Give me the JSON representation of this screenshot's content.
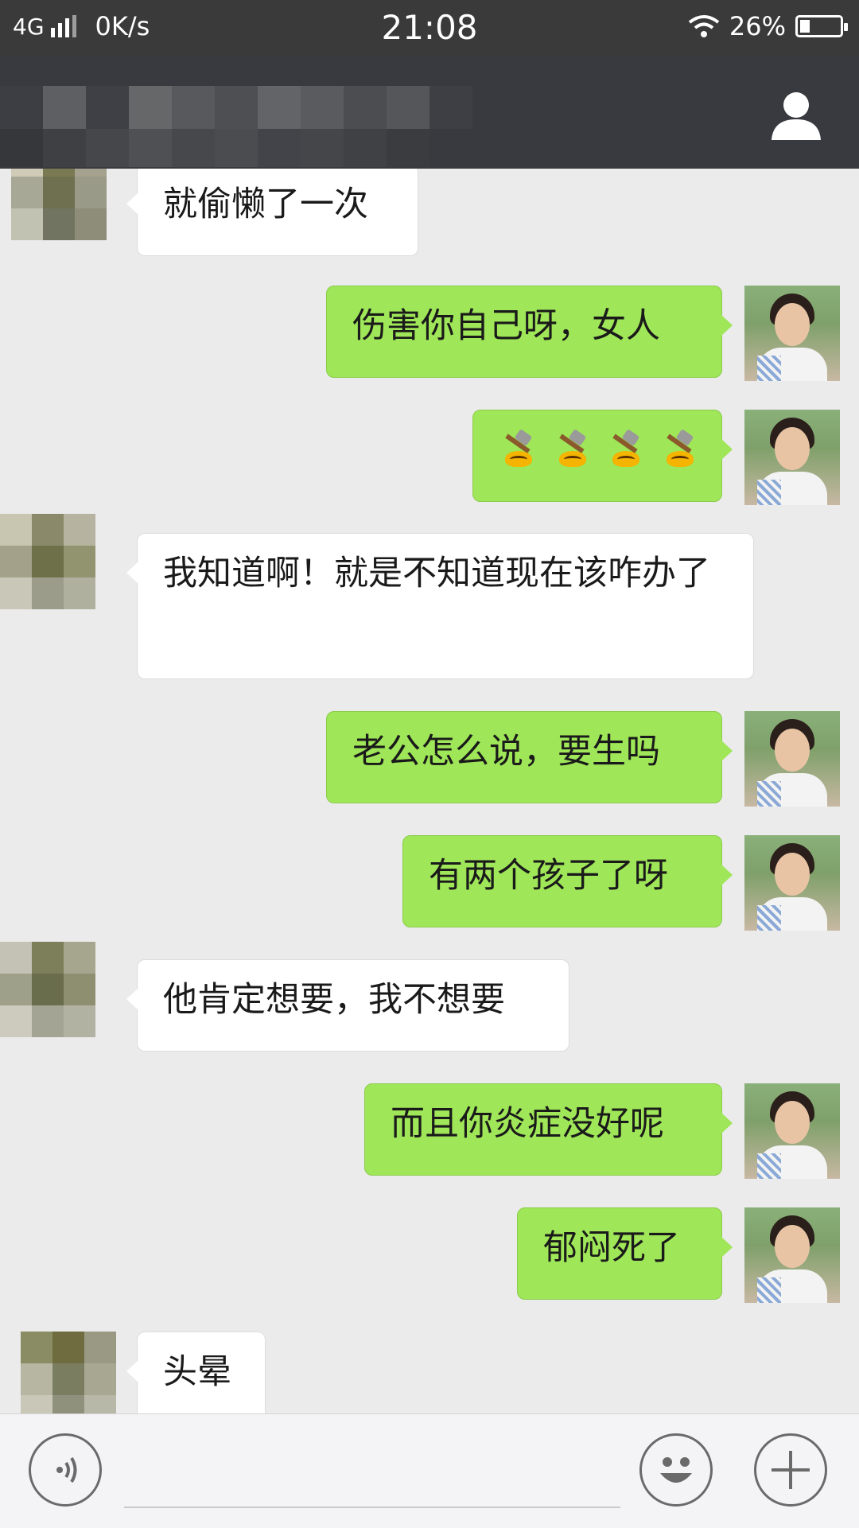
{
  "status_bar": {
    "network": "4G",
    "speed": "0K/s",
    "time": "21:08",
    "battery": "26%",
    "battery_level": 0.26
  },
  "header": {
    "contact_icon": "person-icon"
  },
  "messages": [
    {
      "side": "left",
      "text": "就偷懒了一次"
    },
    {
      "side": "right",
      "text": "伤害你自己呀，女人"
    },
    {
      "side": "right",
      "emoji": "hammer-emoji",
      "count": 4
    },
    {
      "side": "left",
      "text": "我知道啊！就是不知道现在该咋办了"
    },
    {
      "side": "right",
      "text": "老公怎么说，要生吗"
    },
    {
      "side": "right",
      "text": "有两个孩子了呀"
    },
    {
      "side": "left",
      "text": "他肯定想要，我不想要"
    },
    {
      "side": "right",
      "text": "而且你炎症没好呢"
    },
    {
      "side": "right",
      "text": "郁闷死了"
    },
    {
      "side": "left",
      "text": "头晕"
    }
  ],
  "input_bar": {
    "voice_icon": "voice-icon",
    "emoji_icon": "smiley-icon",
    "plus_icon": "plus-icon"
  },
  "colors": {
    "header_bg": "#393a3f",
    "chat_bg": "#ebebeb",
    "bubble_right": "#9fe658",
    "bubble_left": "#ffffff"
  }
}
